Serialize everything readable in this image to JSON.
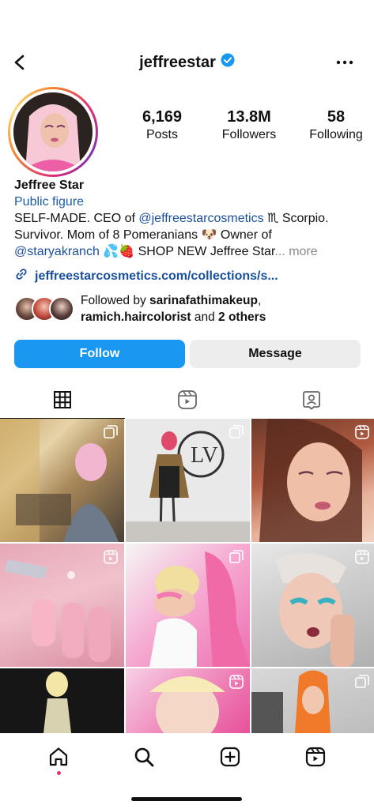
{
  "header": {
    "username": "jeffreestar",
    "verified_color": "#1a97f0"
  },
  "stats": {
    "posts_count": "6,169",
    "posts_label": "Posts",
    "followers_count": "13.8M",
    "followers_label": "Followers",
    "following_count": "58",
    "following_label": "Following"
  },
  "bio": {
    "name": "Jeffree Star",
    "category": "Public figure",
    "line1_prefix": "SELF-MADE. CEO of ",
    "line1_tag": "@jeffreestarcosmetics",
    "line1_suffix": " ♏ Scorpio.",
    "line2": "Survivor. Mom of 8 Pomeranians 🐶 Owner of",
    "line3_tag": "@staryakranch",
    "line3_suffix": " 💦🍓 SHOP NEW Jeffree Star",
    "ellipsis": "...",
    "more": "more",
    "link": "jeffreestarcosmetics.com/collections/s..."
  },
  "followed_by": {
    "prefix": "Followed by ",
    "user1": "sarinafathimakeup",
    "sep": ",",
    "user2": "ramich.haircolorist",
    "middle": " and ",
    "others": "2 others"
  },
  "buttons": {
    "follow": "Follow",
    "message": "Message"
  },
  "tabs": [
    "posts-grid-icon",
    "reels-icon",
    "tagged-icon"
  ],
  "posts": [
    {
      "badge": "carousel-icon"
    },
    {
      "badge": "carousel-icon"
    },
    {
      "badge": "reels-icon"
    },
    {
      "badge": "reels-icon"
    },
    {
      "badge": "carousel-icon"
    },
    {
      "badge": "reels-icon"
    },
    {
      "badge": ""
    },
    {
      "badge": "reels-icon"
    },
    {
      "badge": "carousel-icon"
    }
  ],
  "nav": [
    "home-icon",
    "search-icon",
    "create-icon",
    "reels-icon"
  ],
  "colors": {
    "follow_button": "#1a97f0",
    "message_button": "#ededed",
    "link": "#1a4f9c"
  }
}
